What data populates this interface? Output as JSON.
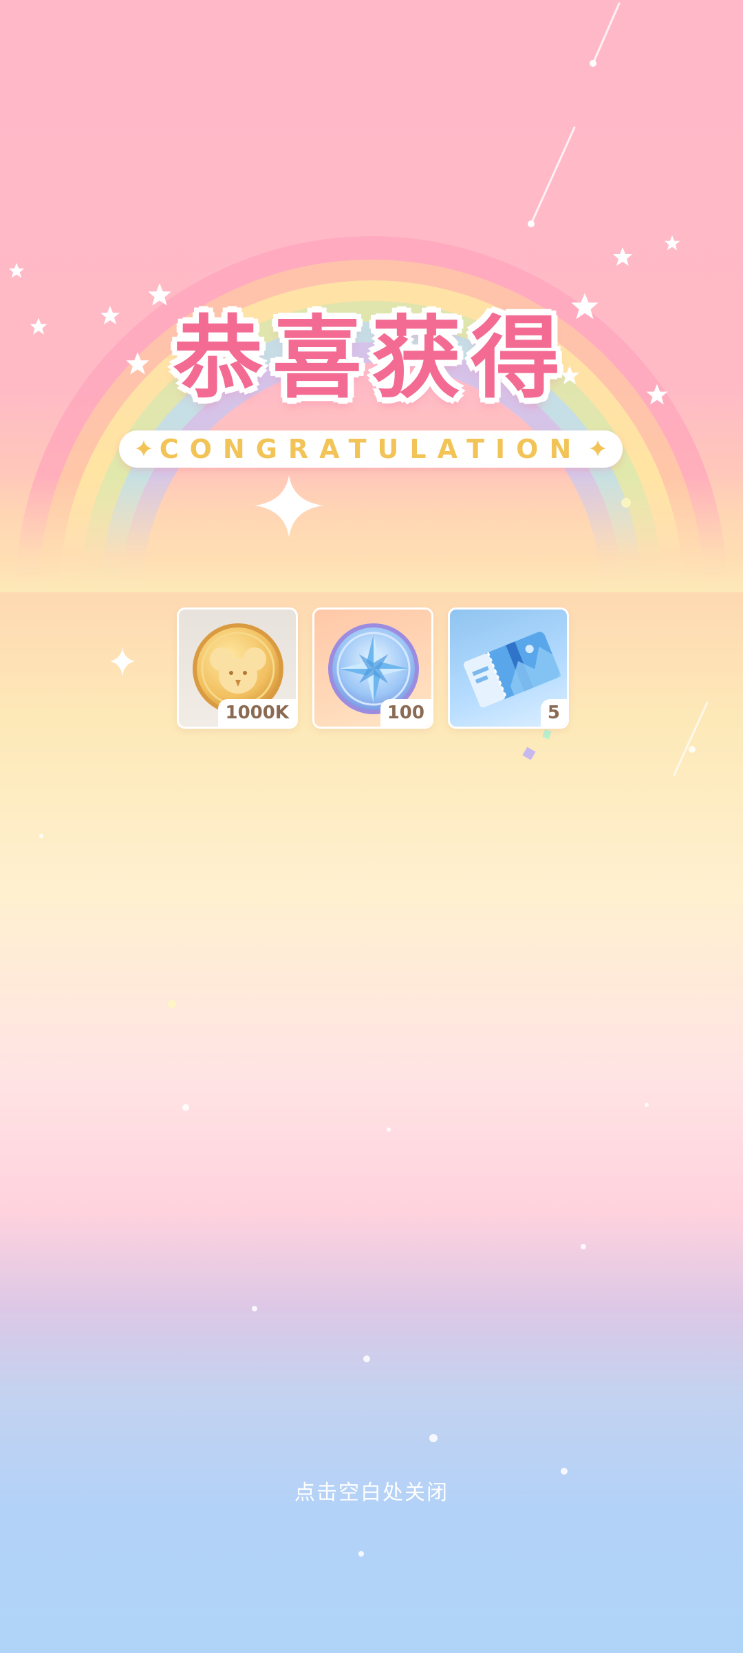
{
  "title": "恭喜获得",
  "subtitle": "CONGRATULATION",
  "rewards": [
    {
      "name": "coin",
      "icon": "koala-gold-coin-icon",
      "count": "1000K"
    },
    {
      "name": "compass-medal",
      "icon": "compass-star-medal-icon",
      "count": "100"
    },
    {
      "name": "ticket",
      "icon": "ticket-icon",
      "count": "5"
    }
  ],
  "close_hint": "点击空白处关闭",
  "colors": {
    "title": "#f36b92",
    "subtitle": "#f2c458",
    "count_text": "#8a6a52",
    "bg_top": "#ffb8c8",
    "bg_bottom": "#b0d4f8"
  }
}
